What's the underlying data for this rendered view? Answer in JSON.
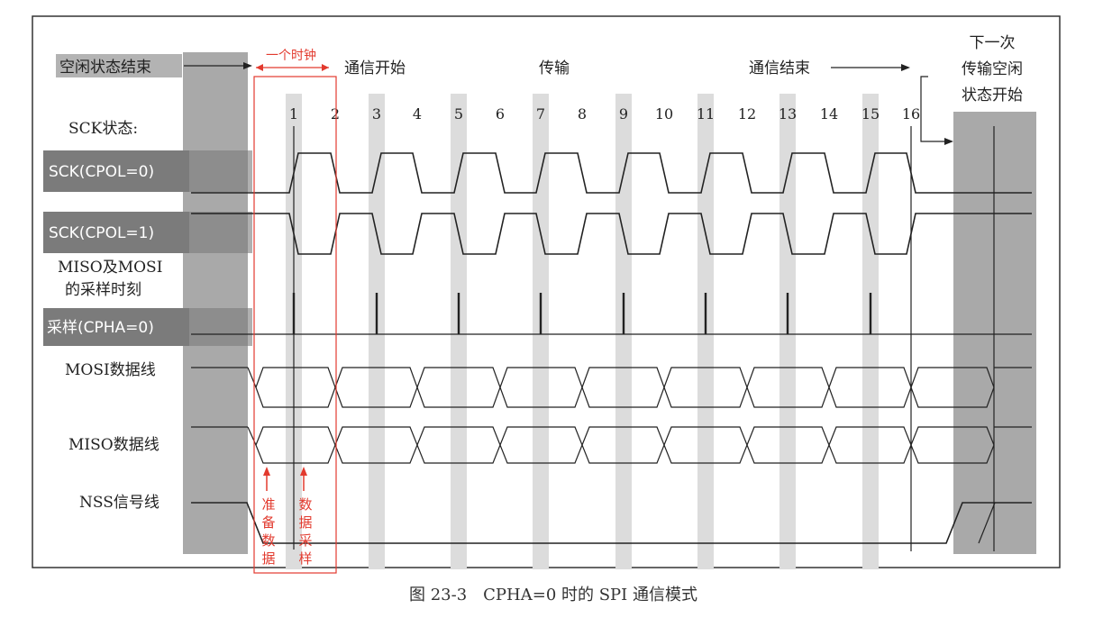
{
  "diagram": {
    "header": {
      "idle_end": "空闲状态结束",
      "one_clock": "一个时钟",
      "comm_start": "通信开始",
      "transfer": "传输",
      "comm_end": "通信结束",
      "next_idle_line1": "下一次",
      "next_idle_line2": "传输空闲",
      "next_idle_line3": "状态开始"
    },
    "sck_state_label": "SCK状态:",
    "clock_numbers": [
      "1",
      "2",
      "3",
      "4",
      "5",
      "6",
      "7",
      "8",
      "9",
      "10",
      "11",
      "12",
      "13",
      "14",
      "15",
      "16"
    ],
    "signals": {
      "sck_cpol0": "SCK(CPOL=0)",
      "sck_cpol1": "SCK(CPOL=1)",
      "sampling_line1": "MISO及MOSI",
      "sampling_line2": "的采样时刻",
      "sampling_box": "采样(CPHA=0)",
      "mosi": "MOSI数据线",
      "miso": "MISO数据线",
      "nss": "NSS信号线"
    },
    "annotations": {
      "prepare_data": [
        "准",
        "备",
        "数",
        "据"
      ],
      "data_sampling": [
        "数",
        "据",
        "采",
        "样"
      ]
    },
    "caption": "图 23-3　CPHA=0 时的 SPI 通信模式",
    "colors": {
      "annotation_red": "#e23a2e",
      "idle_shade": "#a9a9a9",
      "label_box": "#7b7b7b",
      "stripe": "#dcdcdc"
    }
  }
}
